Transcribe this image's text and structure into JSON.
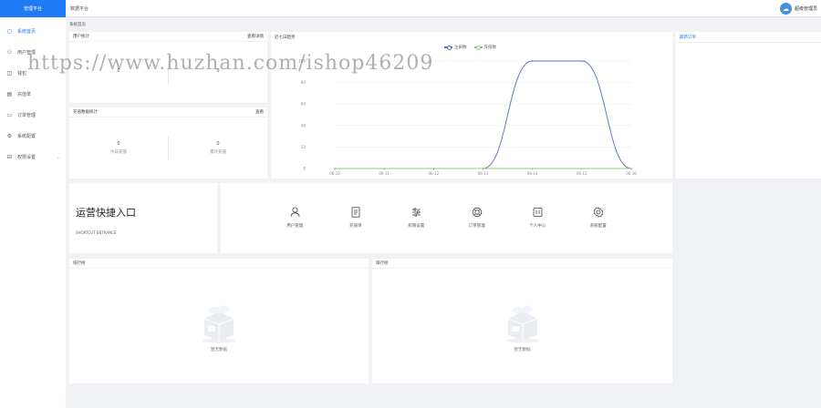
{
  "app": {
    "logo_text": "管理平台"
  },
  "sidebar": {
    "items": [
      {
        "label": "系统首页",
        "icon": "home-icon",
        "active": true
      },
      {
        "label": "用户管理",
        "icon": "user-icon"
      },
      {
        "label": "钱包",
        "icon": "wallet-icon"
      },
      {
        "label": "充值单",
        "icon": "list-icon"
      },
      {
        "label": "订单管理",
        "icon": "order-icon"
      },
      {
        "label": "系统配置",
        "icon": "gear-icon"
      },
      {
        "label": "权限设置",
        "icon": "lock-icon",
        "expandable": true
      }
    ]
  },
  "header": {
    "breadcrumb": "数据平台",
    "username": "超级管理员"
  },
  "tabs": {
    "current": "系统首页"
  },
  "stats_users": {
    "title": "用户统计",
    "link": "查看详情",
    "items": [
      {
        "value": "0",
        "label": ""
      },
      {
        "value": "0",
        "label": ""
      }
    ]
  },
  "stats_data": {
    "title": "充值数据统计",
    "link": "查看",
    "items": [
      {
        "value": "0",
        "label": "今日充值"
      },
      {
        "value": "0",
        "label": "累计充值"
      }
    ]
  },
  "chart_card": {
    "title": "近七日趋势"
  },
  "chart_data": {
    "type": "line",
    "x": [
      "06-10",
      "06-11",
      "06-12",
      "06-13",
      "06-14",
      "06-15",
      "06-16"
    ],
    "ylim": [
      0,
      100
    ],
    "yticks": [
      0,
      20,
      40,
      60,
      80,
      100
    ],
    "legend_position": "top",
    "series": [
      {
        "name": "注册数",
        "color": "#5470c6",
        "values": [
          0,
          0,
          0,
          0,
          100,
          100,
          0
        ]
      },
      {
        "name": "充值数",
        "color": "#91cc75",
        "values": [
          0,
          0,
          0,
          0,
          0,
          0,
          0
        ]
      }
    ]
  },
  "quick_entry": {
    "title": "运营快捷入口",
    "subtitle": "SHORTCUT ENTRANCE"
  },
  "shortcuts": [
    {
      "label": "用户管理",
      "icon": "user-icon"
    },
    {
      "label": "充值单",
      "icon": "document-icon"
    },
    {
      "label": "权限设置",
      "icon": "sliders-icon"
    },
    {
      "label": "订单管理",
      "icon": "lifebuoy-icon"
    },
    {
      "label": "个人中心",
      "icon": "card-icon"
    },
    {
      "label": "系统配置",
      "icon": "settings-icon"
    }
  ],
  "ranking_left": {
    "title": "排行榜",
    "empty_text": "暂无数据"
  },
  "ranking_right": {
    "title": "排行榜",
    "empty_text": "暂无数据"
  },
  "right_panel": {
    "tab": "最新订单"
  },
  "watermark": "https://www.huzhan.com/ishop46209"
}
